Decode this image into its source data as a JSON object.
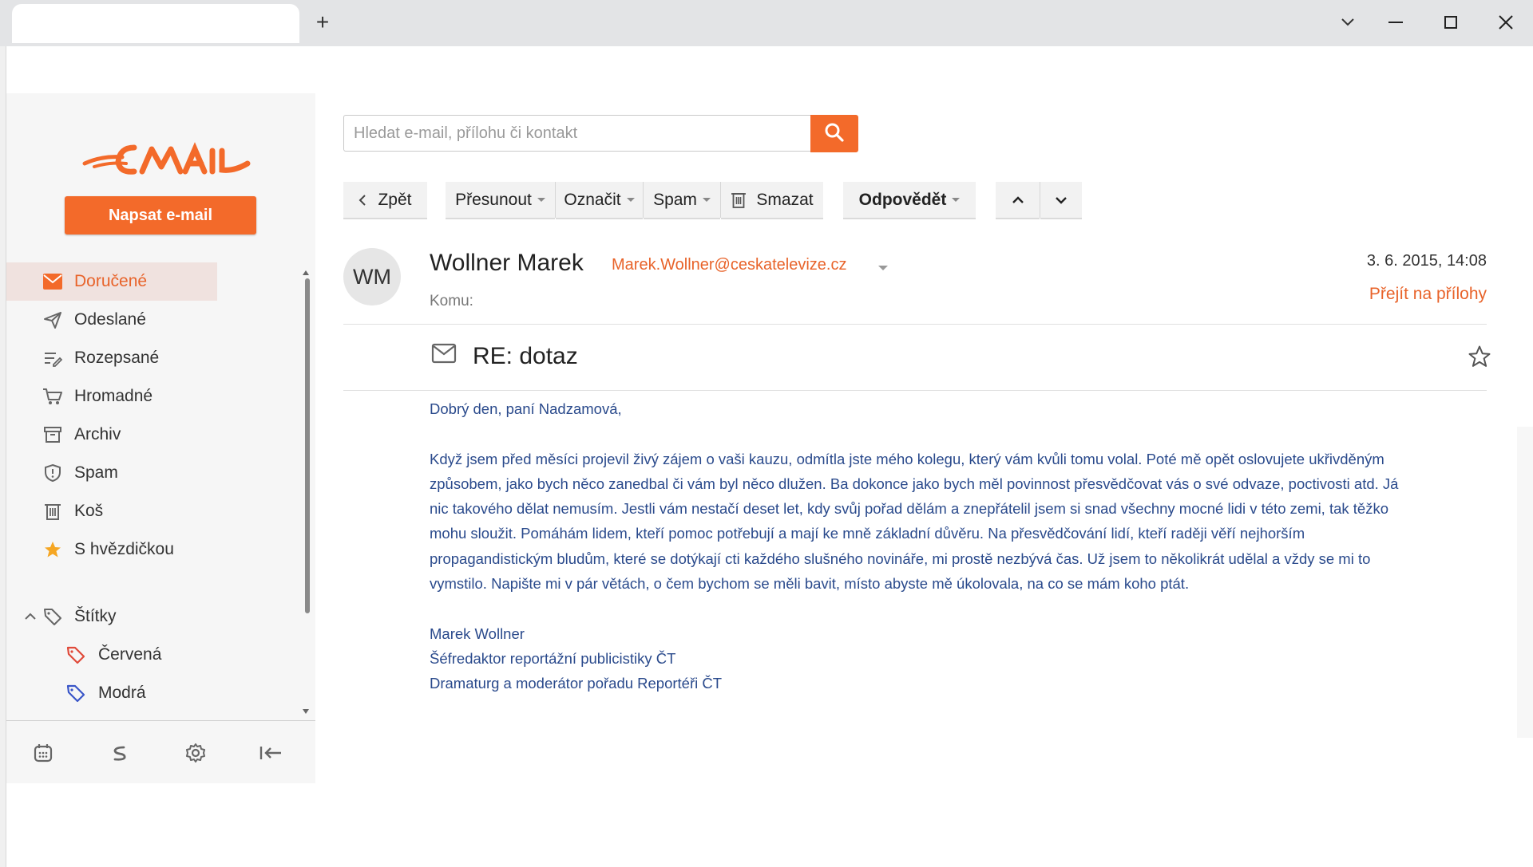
{
  "browser": {
    "new_tab": "+"
  },
  "app": {
    "compose_label": "Napsat e-mail",
    "logo_text": "EMAIL"
  },
  "folders": [
    {
      "label": "Doručené",
      "icon": "inbox-icon"
    },
    {
      "label": "Odeslané",
      "icon": "send-icon"
    },
    {
      "label": "Rozepsané",
      "icon": "drafts-icon"
    },
    {
      "label": "Hromadné",
      "icon": "cart-icon"
    },
    {
      "label": "Archiv",
      "icon": "archive-icon"
    },
    {
      "label": "Spam",
      "icon": "shield-icon"
    },
    {
      "label": "Koš",
      "icon": "trash-icon"
    },
    {
      "label": "S hvězdičkou",
      "icon": "star-icon"
    }
  ],
  "labels": {
    "title": "Štítky",
    "items": [
      {
        "label": "Červená",
        "color": "#e04a3a"
      },
      {
        "label": "Modrá",
        "color": "#3a56c8"
      }
    ]
  },
  "search": {
    "placeholder": "Hledat e-mail, přílohu či kontakt"
  },
  "toolbar": {
    "back": "Zpět",
    "move": "Přesunout",
    "mark": "Označit",
    "spam": "Spam",
    "delete": "Smazat",
    "reply": "Odpovědět"
  },
  "message": {
    "avatar": "WM",
    "sender_name": "Wollner Marek",
    "sender_email": "Marek.Wollner@ceskatelevize.cz",
    "to_label": "Komu:",
    "date": "3. 6. 2015, 14:08",
    "attachments_link": "Přejít na přílohy",
    "subject": "RE: dotaz",
    "greeting": "Dobrý den, paní Nadzamová,",
    "body_lines": [
      "Když jsem před měsíci projevil živý zájem o vaši kauzu, odmítla jste mého kolegu, který vám kvůli tomu volal. Poté mě opět oslovujete ukřivděným",
      "způsobem, jako bych něco zanedbal či vám byl něco dlužen. Ba dokonce jako bych měl povinnost přesvědčovat vás o své odvaze, poctivosti atd. Já",
      "nic takového dělat nemusím. Jestli vám nestačí deset let, kdy svůj pořad dělám a znepřátelil jsem si snad všechny mocné lidi v této zemi, tak těžko",
      "mohu sloužit. Pomáhám lidem, kteří pomoc potřebují a mají ke mně základní důvěru. Na přesvědčování lidí, kteří raději věří nejhorším",
      "propagandistickým bludům, které se dotýkají cti každého slušného novináře, mi prostě nezbývá čas. Už jsem to několikrát udělal a vždy se mi to",
      "vymstilo. Napište mi v pár větách, o čem bychom se měli bavit, místo abyste mě úkolovala, na co se mám koho ptát."
    ],
    "signature": [
      "Marek Wollner",
      "Šéfredaktor reportážní publicistiky ČT",
      "Dramaturg a moderátor pořadu Reportéři ČT"
    ]
  },
  "colors": {
    "accent": "#f36a2a",
    "body_text": "#2a4a8c"
  }
}
